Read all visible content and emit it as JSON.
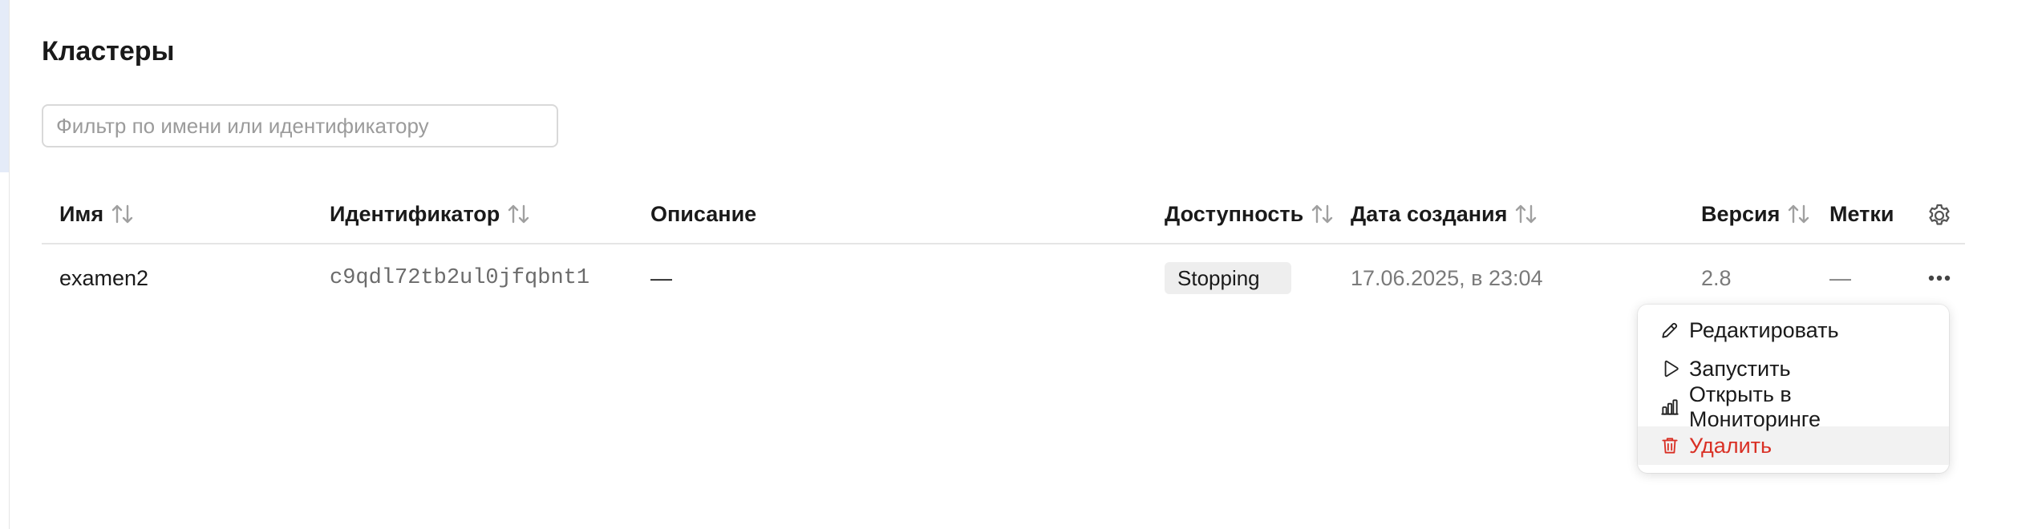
{
  "page": {
    "title": "Кластеры"
  },
  "filter": {
    "placeholder": "Фильтр по имени или идентификатору",
    "value": ""
  },
  "table": {
    "columns": {
      "name": "Имя",
      "id": "Идентификатор",
      "description": "Описание",
      "availability": "Доступность",
      "created": "Дата создания",
      "version": "Версия",
      "labels": "Метки"
    },
    "rows": [
      {
        "name": "examen2",
        "id": "c9qdl72tb2ul0jfqbnt1",
        "description": "—",
        "availability": "Stopping",
        "created": "17.06.2025, в 23:04",
        "version": "2.8",
        "labels": "—"
      }
    ]
  },
  "menu": {
    "items": [
      {
        "label": "Редактировать",
        "icon": "pencil-icon"
      },
      {
        "label": "Запустить",
        "icon": "play-icon"
      },
      {
        "label": "Открыть в Мониторинге",
        "icon": "bar-chart-icon"
      },
      {
        "label": "Удалить",
        "icon": "trash-icon",
        "color": "#d93025"
      }
    ]
  },
  "colors": {
    "danger": "#d93025",
    "border": "#e5e5e5",
    "accent_strip": "#e4ebf8"
  }
}
